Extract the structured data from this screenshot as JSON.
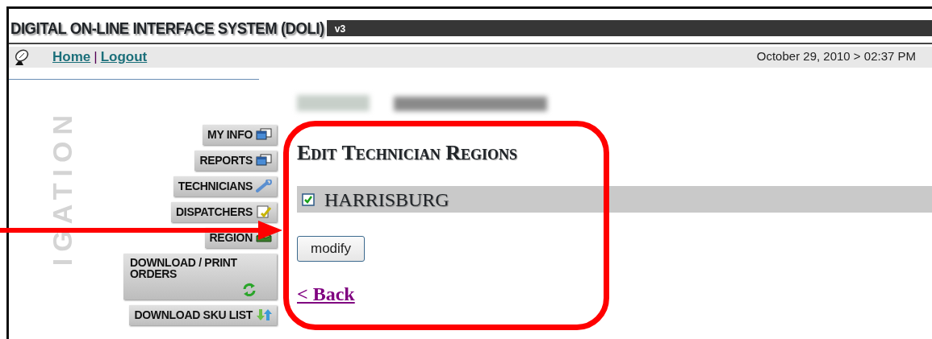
{
  "header": {
    "title": "DIGITAL ON-LINE INTERFACE SYSTEM (DOLI)",
    "version": "v3"
  },
  "topbar": {
    "links": [
      "Home",
      "Logout"
    ],
    "separator": "|",
    "datetime": "October 29, 2010 > 02:37 PM"
  },
  "sidebar": {
    "vertical_label": "IGATION",
    "items": [
      {
        "label": "MY INFO",
        "kind": "windows"
      },
      {
        "label": "REPORTS",
        "kind": "windows"
      },
      {
        "label": "TECHNICIANS",
        "kind": "wrench"
      },
      {
        "label": "DISPATCHERS",
        "kind": "notepad"
      },
      {
        "label": "REGION",
        "kind": "box"
      },
      {
        "label": "DOWNLOAD / PRINT ORDERS",
        "kind": "refresh"
      },
      {
        "label": "DOWNLOAD SKU LIST",
        "kind": "updown"
      }
    ]
  },
  "content": {
    "heading": "Edit Technician Regions",
    "regions": [
      {
        "label": "HARRISBURG",
        "checked": true
      }
    ],
    "button": "modify",
    "back_link": "< Back"
  },
  "annotations": {
    "highlight_frame": true,
    "pointer_arrow": true
  }
}
